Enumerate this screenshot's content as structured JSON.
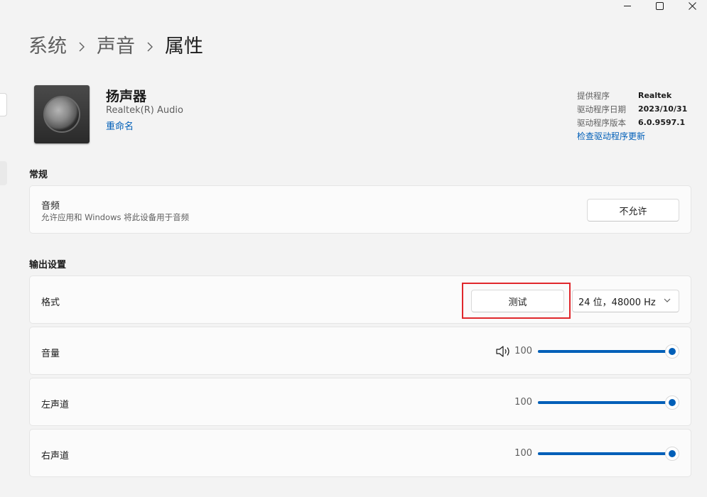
{
  "window": {
    "minimize_icon": "minimize-icon",
    "maximize_icon": "maximize-icon",
    "close_icon": "close-icon"
  },
  "breadcrumb": {
    "items": [
      "系统",
      "声音",
      "属性"
    ],
    "separator_icon": "chevron-right-icon"
  },
  "device": {
    "icon": "speaker-device-icon",
    "name": "扬声器",
    "driver": "Realtek(R) Audio",
    "rename": "重命名"
  },
  "driver_info": {
    "rows": [
      {
        "label": "提供程序",
        "value": "Realtek"
      },
      {
        "label": "驱动程序日期",
        "value": "2023/10/31"
      },
      {
        "label": "驱动程序版本",
        "value": "6.0.9597.1"
      }
    ],
    "update_link": "检查驱动程序更新"
  },
  "general": {
    "header": "常规",
    "audio": {
      "title": "音频",
      "description": "允许应用和 Windows 将此设备用于音频",
      "button": "不允许"
    }
  },
  "output": {
    "header": "输出设置",
    "format": {
      "title": "格式",
      "test_button": "测试",
      "selected": "24 位，48000 Hz"
    },
    "volume": {
      "title": "音量",
      "value": "100",
      "level": 1.0,
      "icon": "speaker-volume-icon"
    },
    "left": {
      "title": "左声道",
      "value": "100",
      "level": 1.0
    },
    "right": {
      "title": "右声道",
      "value": "100",
      "level": 1.0
    }
  },
  "colors": {
    "accent": "#005fb8",
    "highlight": "#e0272c",
    "background": "#f3f3f3",
    "card": "#fbfbfb"
  }
}
